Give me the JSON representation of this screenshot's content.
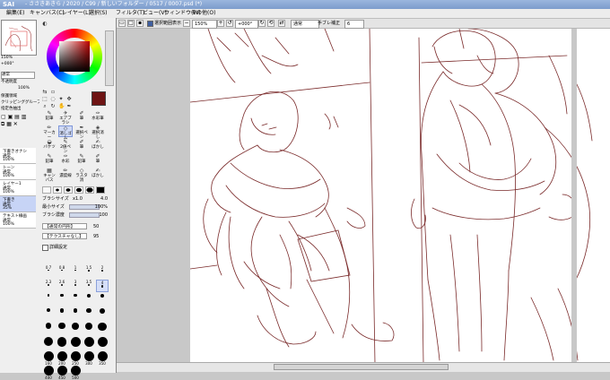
{
  "titlebar": {
    "app": "SAI",
    "path": "- ささきあきら / 2020 / C99 / 新しいフォルダー / 0517 / 0007.psd (*)"
  },
  "menu": [
    "編集(E)",
    "キャンバス(C)",
    "レイヤー(L)",
    "選択(S)",
    "フィルタ(T)",
    "ビュー(V)",
    "ウィンドウ(W)",
    "その他(O)"
  ],
  "toolbar": {
    "check1_label": "選択範囲表示",
    "zoom": "150%",
    "angle": "+000°",
    "mode": "通常",
    "stabilizer_label": "手ブレ補正",
    "stabilizer_value": "6"
  },
  "navigator": {
    "zoom": "150%",
    "angle": "+000°"
  },
  "layer_panel": {
    "mode": "通常",
    "opacity_label": "不透明度",
    "opacity_value": "100%",
    "options": [
      "保護領域",
      "クリッピンググループ",
      "指定色抽出"
    ],
    "layers": [
      {
        "name": "下書きオナシ",
        "mode": "通常",
        "opacity": "100%"
      },
      {
        "name": "トーン",
        "mode": "通常",
        "opacity": "100%"
      },
      {
        "name": "レイヤー1",
        "mode": "通常",
        "opacity": "100%"
      },
      {
        "name": "下書き",
        "mode": "通常",
        "opacity": "35%"
      },
      {
        "name": "テキスト線画",
        "mode": "通常",
        "opacity": "100%"
      }
    ]
  },
  "tools": [
    {
      "name": "鉛筆",
      "icon": "pencil-icon"
    },
    {
      "name": "エアブラシ",
      "icon": "airbrush-icon"
    },
    {
      "name": "筆",
      "icon": "brush-icon"
    },
    {
      "name": "水彩筆",
      "icon": "watercolor-icon"
    },
    {
      "name": "マーカー",
      "icon": "marker-icon"
    },
    {
      "name": "消しゴム",
      "icon": "eraser-icon"
    },
    {
      "name": "選択ペン",
      "icon": "select-pen-icon"
    },
    {
      "name": "選択消し",
      "icon": "select-erase-icon"
    },
    {
      "name": "バケツ",
      "icon": "bucket-icon"
    },
    {
      "name": "2値ペン",
      "icon": "binary-pen-icon"
    },
    {
      "name": "筆",
      "icon": "brush-icon"
    },
    {
      "name": "ぼかし",
      "icon": "blur-icon"
    },
    {
      "name": "鉛筆",
      "icon": "pencil-icon"
    },
    {
      "name": "水彩",
      "icon": "watercolor-icon"
    },
    {
      "name": "鉛筆",
      "icon": "pencil-icon"
    },
    {
      "name": "筆",
      "icon": "brush-icon"
    },
    {
      "name": "キャンバス",
      "icon": "canvas-icon"
    },
    {
      "name": "濃度線",
      "icon": "density-icon"
    },
    {
      "name": "ラスタ消",
      "icon": "raster-erase-icon"
    },
    {
      "name": "ぼかし",
      "icon": "blur-icon"
    }
  ],
  "brush": {
    "size_label": "ブラシサイズ",
    "size_mult": "x1.0",
    "size_value": "4.0",
    "min_label": "最小サイズ",
    "min_value": "100%",
    "density_label": "ブラシ濃度",
    "density_value": "100",
    "texture1": "【通常の円形】",
    "texture2": "【テクスチャなし】",
    "texture_strength1": "50",
    "texture_strength2": "95",
    "detail_label": "詳細設定"
  },
  "brush_sizes": [
    "0.7",
    "0.8",
    "1",
    "1.5",
    "2",
    "2.3",
    "2.6",
    "3",
    "3.5",
    "4",
    "5",
    "6",
    "7",
    "8",
    "9",
    "10",
    "12",
    "14",
    "16",
    "20",
    "25",
    "30",
    "35",
    "40",
    "50",
    "60",
    "70",
    "80",
    "100",
    "120",
    "160",
    "200",
    "250",
    "300",
    "350",
    "400",
    "450",
    "500"
  ],
  "colors": {
    "brush": "#6e1414",
    "accent": "#7c9ccc",
    "line": "#7a2a2a"
  }
}
